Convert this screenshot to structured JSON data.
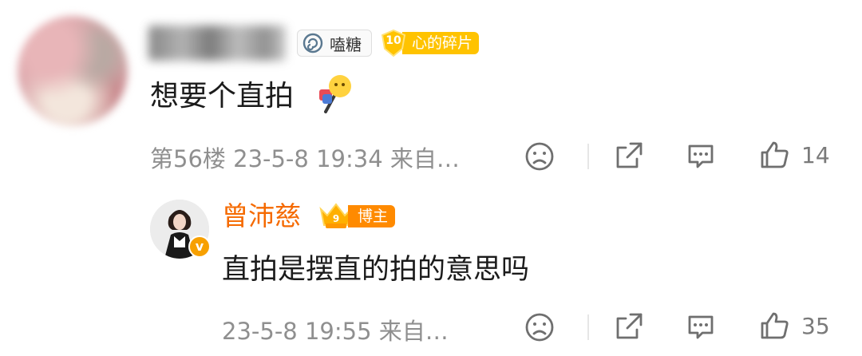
{
  "main_comment": {
    "badge_candy_label": "嗑糖",
    "badge_level_number": "10",
    "badge_level_label": "心的碎片",
    "content": "想要个直拍",
    "meta": "第56楼  23-5-8 19:34  来自…",
    "like_count": "14",
    "icons": [
      "dislike-face-icon",
      "share-icon",
      "comment-icon",
      "like-thumb-icon"
    ]
  },
  "reply": {
    "username": "曾沛慈",
    "blogger_badge_label": "博主",
    "crown_number": "9",
    "verified_mark": "v",
    "content": "直拍是摆直的拍的意思吗",
    "meta": "23-5-8 19:55  来自…",
    "like_count": "35"
  },
  "colors": {
    "reply_username": "#f56a00",
    "level_badge": "#ffc300",
    "blogger_badge": "#ff8a00",
    "meta_text": "#8f8f8f"
  }
}
